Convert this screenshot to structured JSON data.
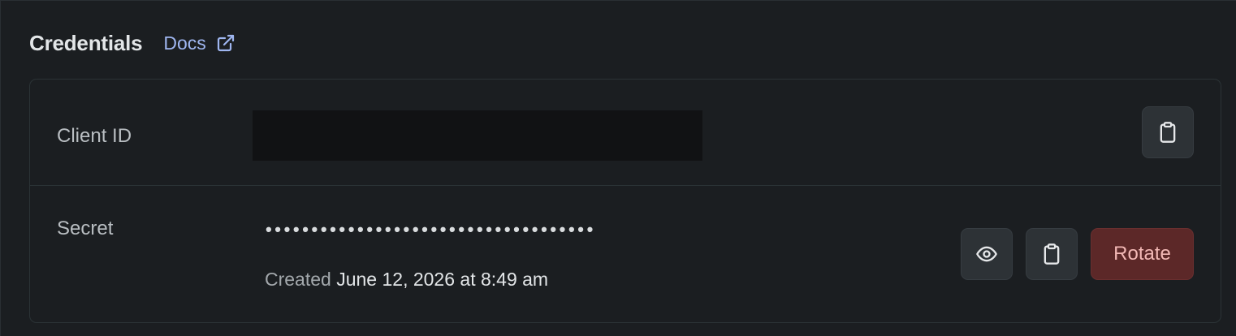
{
  "header": {
    "title": "Credentials",
    "docs_label": "Docs"
  },
  "client_id": {
    "label": "Client ID",
    "value_redacted": true
  },
  "secret": {
    "label": "Secret",
    "masked_value": "••••••••••••••••••••••••••••••••••••",
    "created_prefix": "Created",
    "created_value": "June 12, 2026 at 8:49 am",
    "rotate_label": "Rotate"
  },
  "icons": {
    "docs": "external-link-icon",
    "copy": "clipboard-icon",
    "reveal": "eye-icon"
  },
  "colors": {
    "accent_link": "#9fb6f0",
    "danger_bg": "#5c2828",
    "danger_text": "#f2b8b5"
  }
}
